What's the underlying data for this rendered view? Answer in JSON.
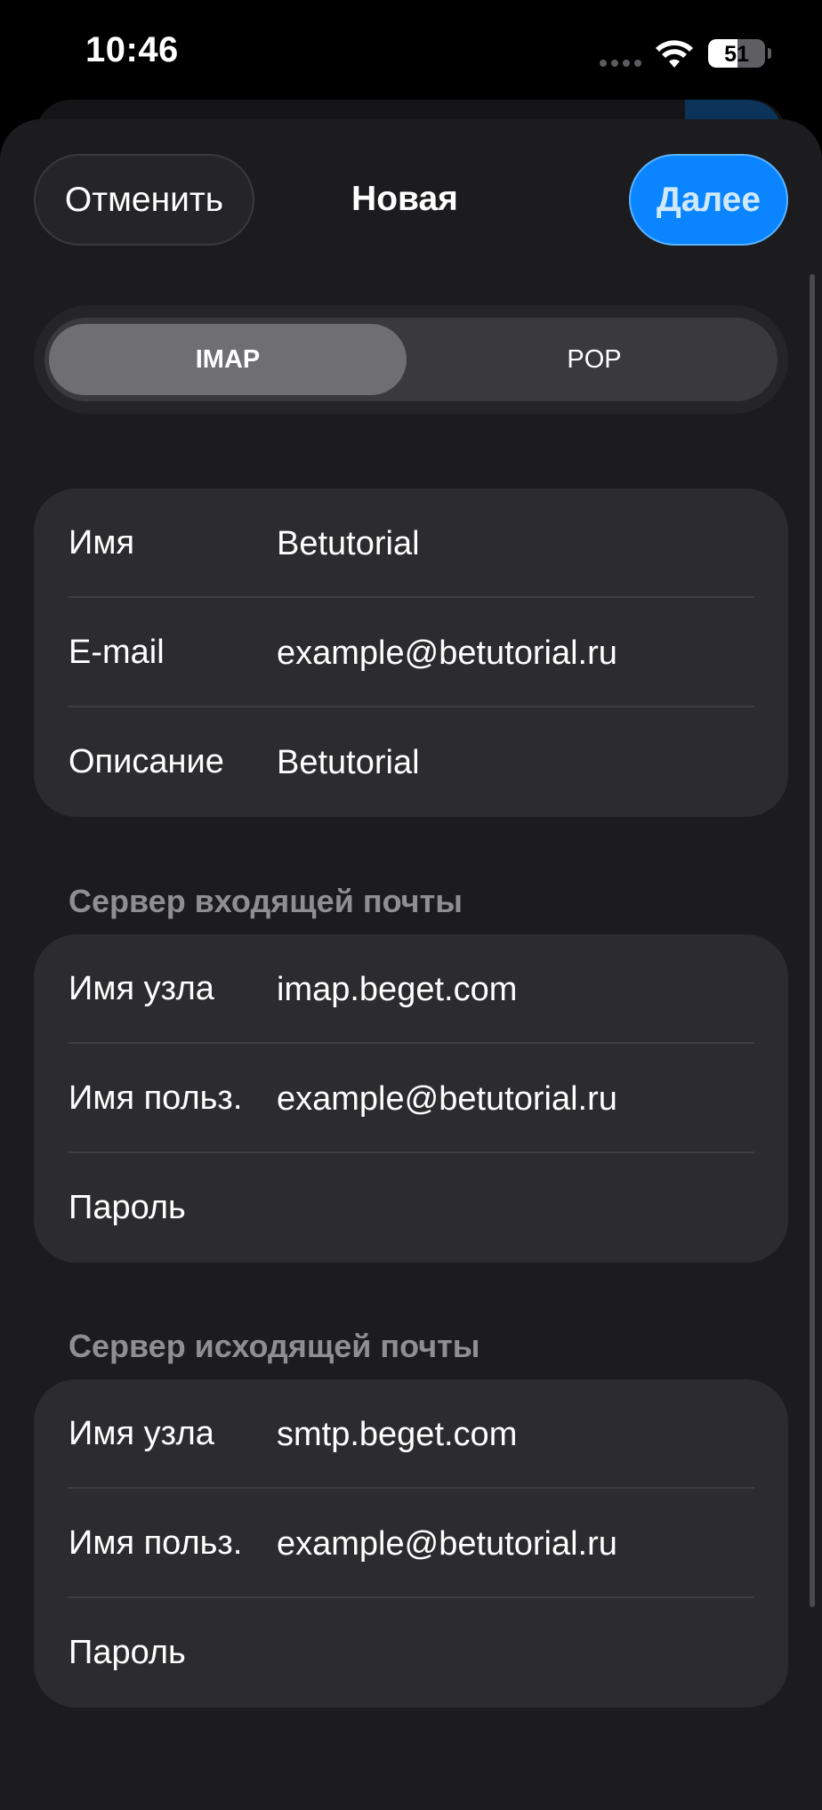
{
  "status_bar": {
    "time": "10:46",
    "battery": "51",
    "battery_level": 0.51
  },
  "header": {
    "cancel_label": "Отменить",
    "title": "Новая",
    "next_label": "Далее"
  },
  "segments": [
    {
      "label": "IMAP",
      "selected": true
    },
    {
      "label": "POP",
      "selected": false
    }
  ],
  "account": {
    "rows": [
      {
        "label": "Имя",
        "value": "Betutorial"
      },
      {
        "label": "E-mail",
        "value": "example@betutorial.ru"
      },
      {
        "label": "Описание",
        "value": "Betutorial"
      }
    ]
  },
  "incoming": {
    "header": "Сервер входящей почты",
    "rows": [
      {
        "label": "Имя узла",
        "value": "imap.beget.com"
      },
      {
        "label": "Имя польз.",
        "value": "example@betutorial.ru"
      },
      {
        "label": "Пароль",
        "value": ""
      }
    ]
  },
  "outgoing": {
    "header": "Сервер исходящей почты",
    "rows": [
      {
        "label": "Имя узла",
        "value": "smtp.beget.com"
      },
      {
        "label": "Имя польз.",
        "value": "example@betutorial.ru"
      },
      {
        "label": "Пароль",
        "value": ""
      }
    ]
  },
  "colors": {
    "accent": "#0a84ff",
    "background": "#1c1c1e",
    "group": "#2c2c2e",
    "section_header": "#8e8e93"
  },
  "icons": [
    "wifi-icon",
    "battery-icon",
    "cellular-signal-icon"
  ]
}
